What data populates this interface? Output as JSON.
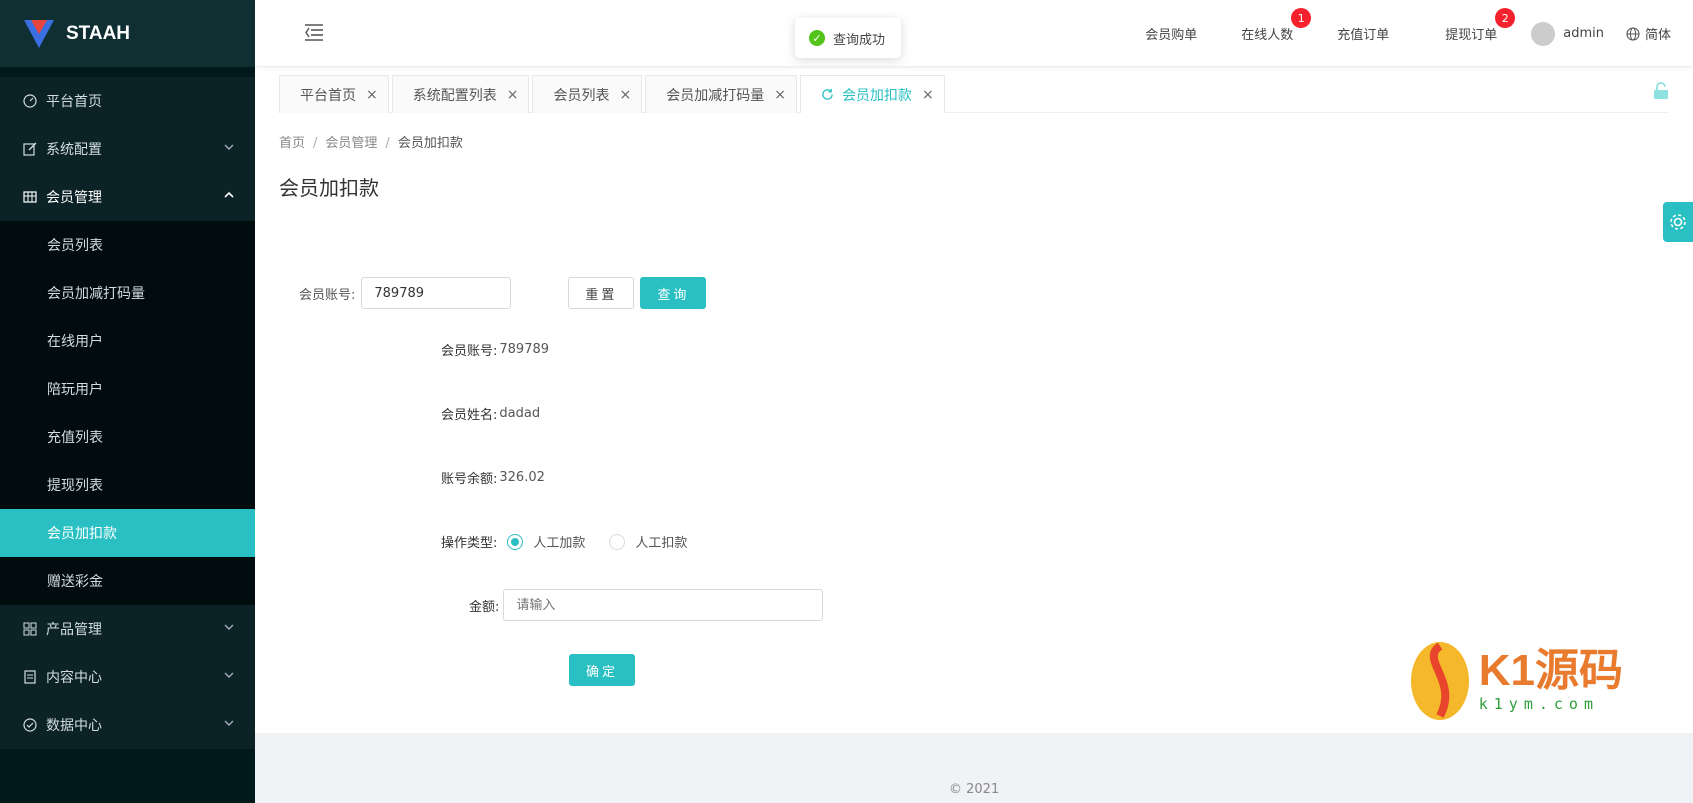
{
  "brand": {
    "name": "STAAH"
  },
  "sidebar": {
    "items": [
      {
        "label": "平台首页",
        "icon": "dashboard-icon"
      },
      {
        "label": "系统配置",
        "icon": "edit-icon"
      },
      {
        "label": "会员管理",
        "icon": "table-icon"
      },
      {
        "label": "产品管理",
        "icon": "grid-icon"
      },
      {
        "label": "内容中心",
        "icon": "document-icon"
      },
      {
        "label": "数据中心",
        "icon": "check-circle-icon"
      }
    ],
    "submenu": [
      {
        "label": "会员列表"
      },
      {
        "label": "会员加减打码量"
      },
      {
        "label": "在线用户"
      },
      {
        "label": "陪玩用户"
      },
      {
        "label": "充值列表"
      },
      {
        "label": "提现列表"
      },
      {
        "label": "会员加扣款"
      },
      {
        "label": "赠送彩金"
      }
    ]
  },
  "toast": {
    "text": "查询成功"
  },
  "topbar": {
    "links": [
      {
        "label": "会员购单"
      },
      {
        "label": "在线人数",
        "badge": "1"
      },
      {
        "label": "充值订单"
      },
      {
        "label": "提现订单",
        "badge": "2"
      }
    ],
    "user": "admin",
    "lang": "简体"
  },
  "tabs": [
    {
      "label": "平台首页"
    },
    {
      "label": "系统配置列表"
    },
    {
      "label": "会员列表"
    },
    {
      "label": "会员加减打码量"
    },
    {
      "label": "会员加扣款"
    }
  ],
  "breadcrumb": [
    "首页",
    "会员管理",
    "会员加扣款"
  ],
  "page": {
    "title": "会员加扣款",
    "search": {
      "label": "会员账号:",
      "value": "789789",
      "reset": "重置",
      "query": "查询"
    },
    "info": {
      "account_label": "会员账号:",
      "account": "789789",
      "name_label": "会员姓名:",
      "name": "dadad",
      "balance_label": "账号余额:",
      "balance": "326.02",
      "op_label": "操作类型:",
      "op_add": "人工加款",
      "op_deduct": "人工扣款",
      "amount_label": "金额:",
      "amount_placeholder": "请输入",
      "submit": "确定"
    }
  },
  "footer": {
    "text": "© 2021"
  },
  "watermark": {
    "big": "K1源码",
    "small": "k1ym.com"
  },
  "colors": {
    "accent": "#2ac0c3",
    "sidebar_bg": "#001a1c",
    "badge": "#f5222d",
    "success": "#52c41a"
  }
}
